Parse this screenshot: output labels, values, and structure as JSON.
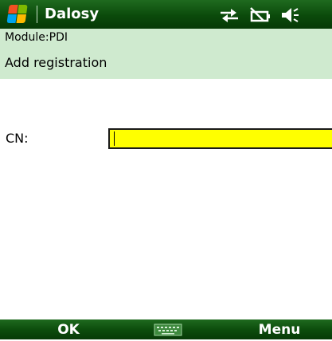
{
  "status_bar": {
    "app_title": "Dalosy",
    "icons": [
      "windows-start-icon",
      "connectivity-icon",
      "battery-icon",
      "volume-icon"
    ]
  },
  "header": {
    "module_label": "Module:PDI",
    "page_title": "Add registration"
  },
  "form": {
    "cn_label": "CN:",
    "cn_value": "",
    "cn_placeholder": ""
  },
  "softkeys": {
    "left_label": "OK",
    "center_icon": "keyboard-icon",
    "right_label": "Menu"
  },
  "colors": {
    "title_bar_green": "#0b4a0b",
    "header_band": "#cfeacf",
    "input_highlight": "#ffff00",
    "text": "#000000",
    "title_text": "#ffffff"
  }
}
